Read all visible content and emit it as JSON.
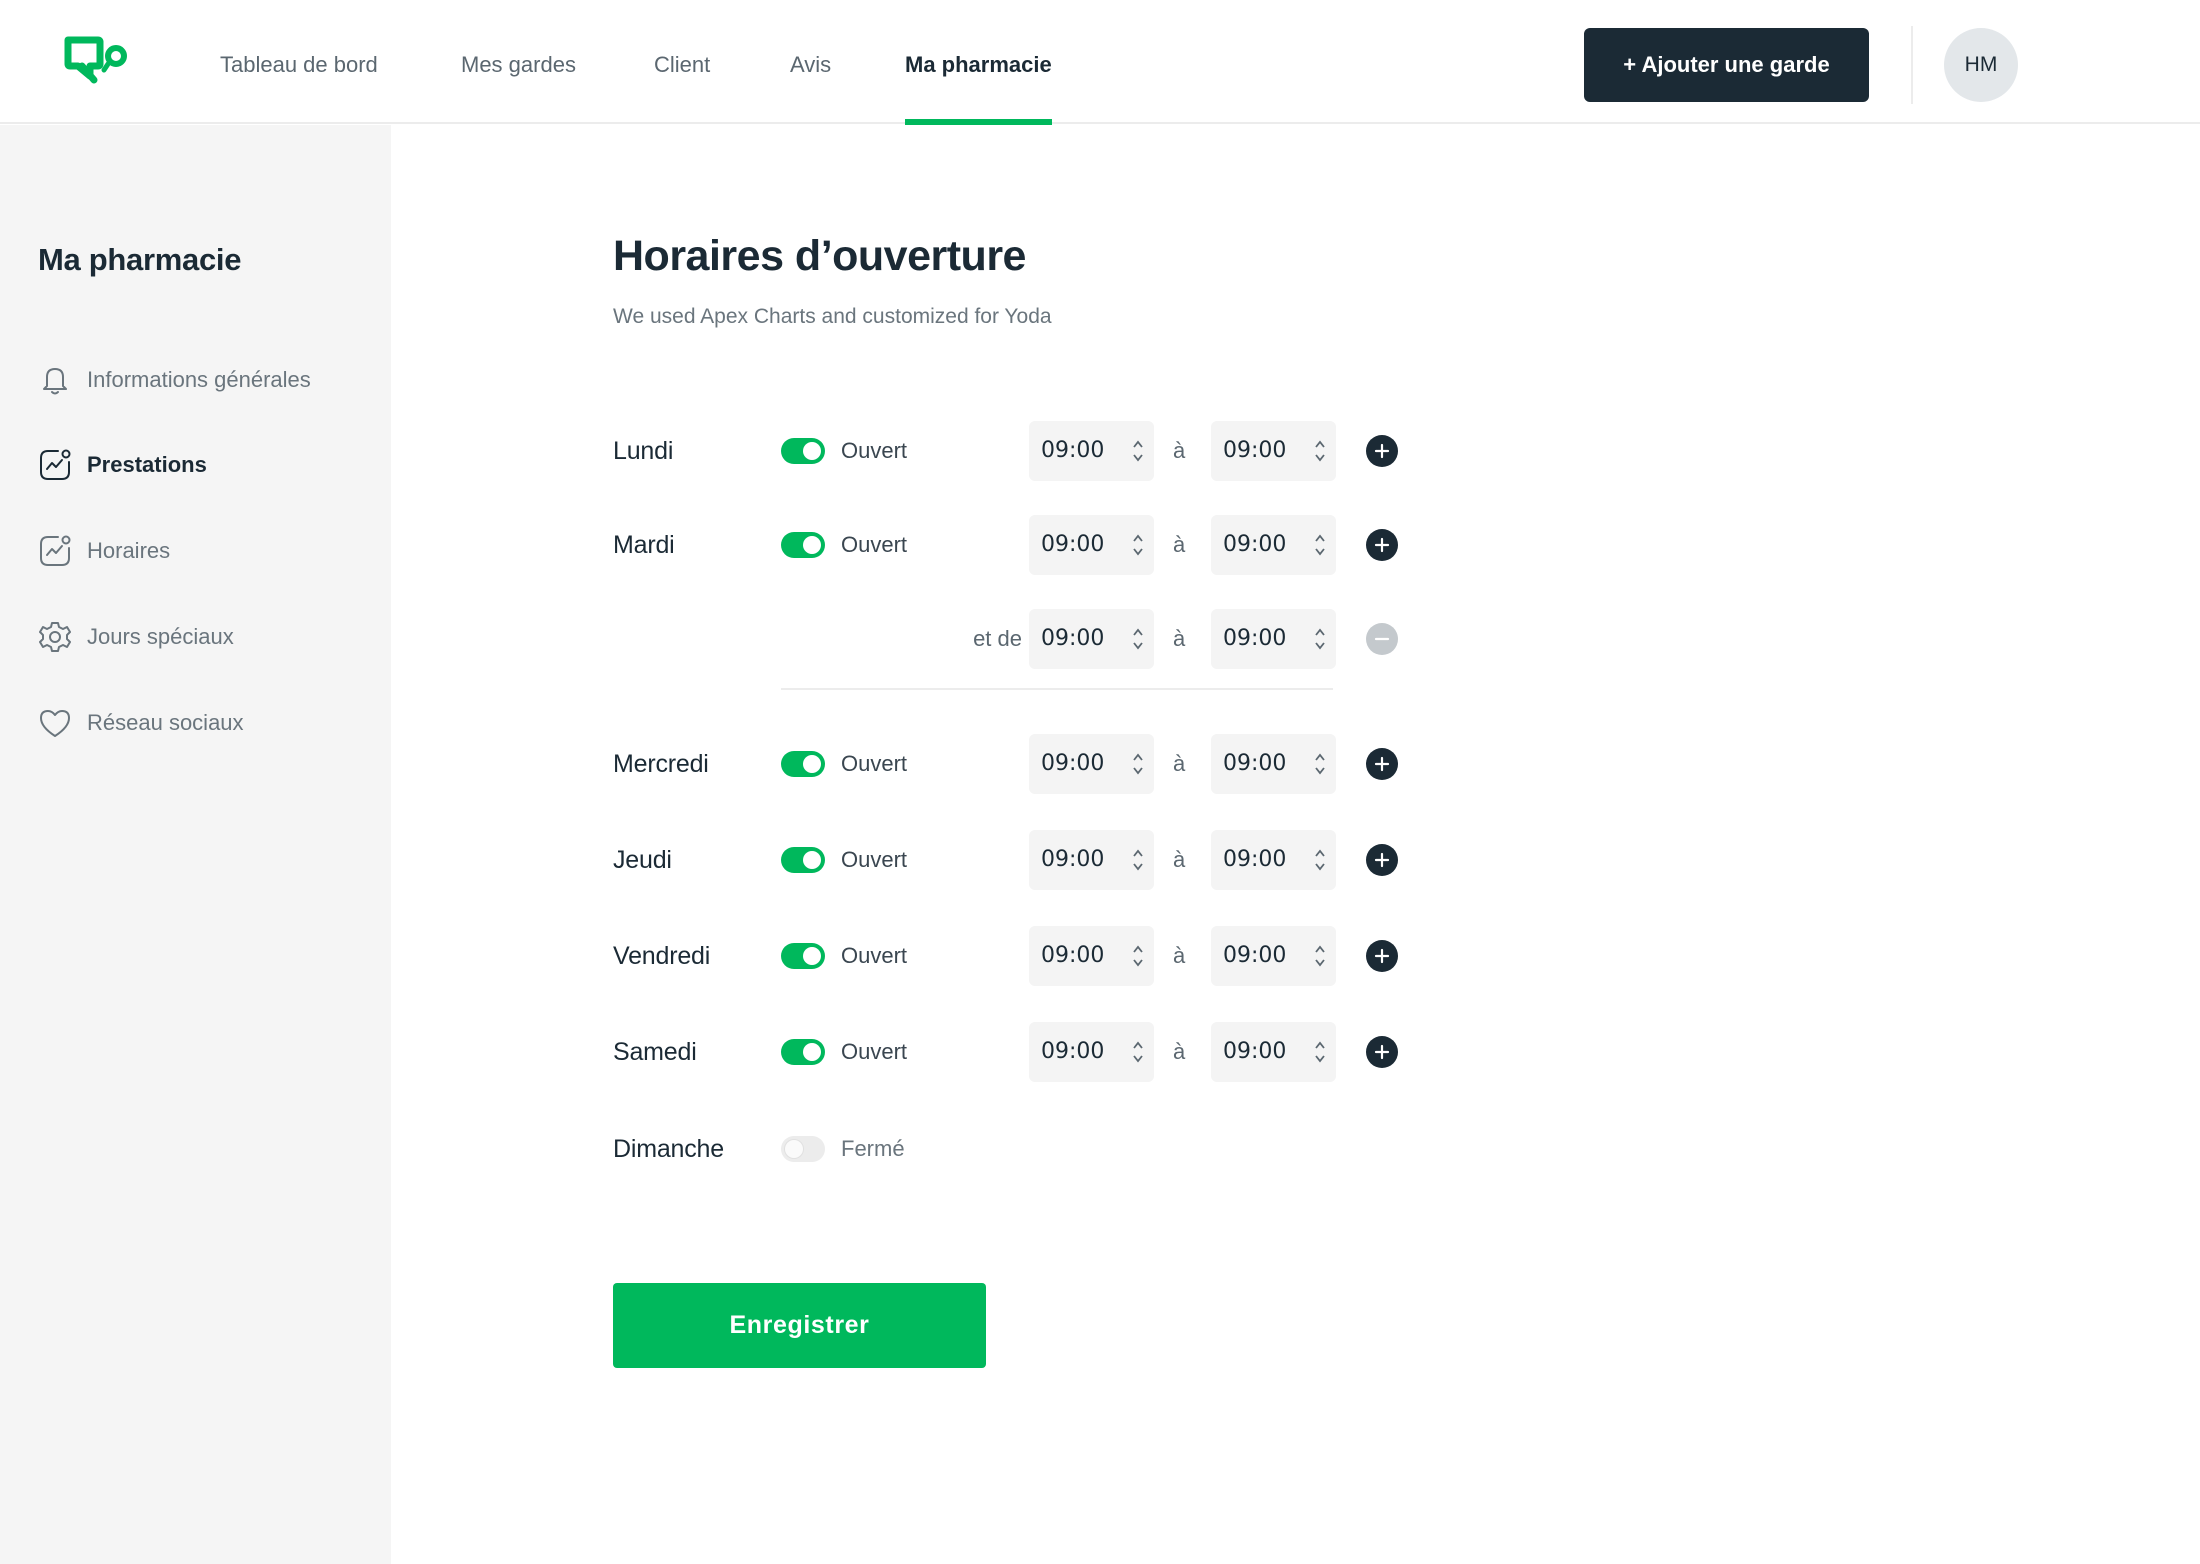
{
  "header": {
    "nav": [
      {
        "label": "Tableau de bord",
        "active": false
      },
      {
        "label": "Mes gardes",
        "active": false
      },
      {
        "label": "Client",
        "active": false
      },
      {
        "label": "Avis",
        "active": false
      },
      {
        "label": "Ma pharmacie",
        "active": true
      }
    ],
    "add_button_label": "+ Ajouter une garde",
    "avatar_initials": "HM"
  },
  "sidebar": {
    "title": "Ma pharmacie",
    "items": [
      {
        "label": "Informations générales",
        "icon": "bell-icon",
        "active": false
      },
      {
        "label": "Prestations",
        "icon": "activity-chart-icon",
        "active": true
      },
      {
        "label": "Horaires",
        "icon": "activity-chart-icon",
        "active": false
      },
      {
        "label": "Jours spéciaux",
        "icon": "gear-icon",
        "active": false
      },
      {
        "label": "Réseau sociaux",
        "icon": "heart-icon",
        "active": false
      }
    ]
  },
  "main": {
    "title": "Horaires d’ouverture",
    "subtitle": "We used Apex Charts and customized for Yoda",
    "separator": "à",
    "extra_slot_label": "et de",
    "days": [
      {
        "name": "Lundi",
        "open": true,
        "status": "Ouvert",
        "from": "09:00",
        "to": "09:00"
      },
      {
        "name": "Mardi",
        "open": true,
        "status": "Ouvert",
        "from": "09:00",
        "to": "09:00",
        "extra": {
          "from": "09:00",
          "to": "09:00"
        }
      },
      {
        "name": "Mercredi",
        "open": true,
        "status": "Ouvert",
        "from": "09:00",
        "to": "09:00"
      },
      {
        "name": "Jeudi",
        "open": true,
        "status": "Ouvert",
        "from": "09:00",
        "to": "09:00"
      },
      {
        "name": "Vendredi",
        "open": true,
        "status": "Ouvert",
        "from": "09:00",
        "to": "09:00"
      },
      {
        "name": "Samedi",
        "open": true,
        "status": "Ouvert",
        "from": "09:00",
        "to": "09:00"
      },
      {
        "name": "Dimanche",
        "open": false,
        "status": "Fermé"
      }
    ],
    "save_label": "Enregistrer"
  },
  "colors": {
    "brand_green": "#00b85c",
    "dark": "#1b2a35",
    "sidebar_bg": "#f5f5f5"
  }
}
